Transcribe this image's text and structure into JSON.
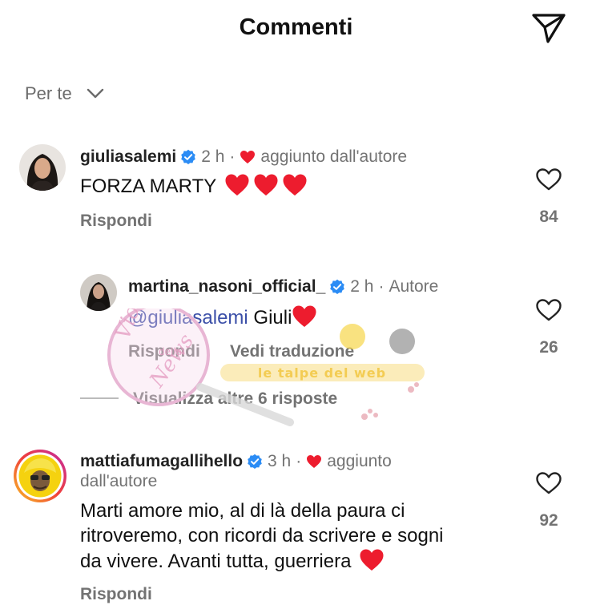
{
  "header": {
    "title": "Commenti",
    "share_icon": "paper-plane-icon"
  },
  "filter": {
    "label": "Per te",
    "icon": "chevron-down-icon"
  },
  "comments": [
    {
      "username": "giuliasalemi",
      "verified": true,
      "time": "2 h",
      "badge": "aggiunto dall'autore",
      "text": "FORZA MARTY",
      "hearts": 3,
      "reply_label": "Rispondi",
      "likes": "84"
    },
    {
      "username": "martina_nasoni_official_",
      "verified": true,
      "time": "2 h",
      "badge": "Autore",
      "mention": "@giuliasalemi",
      "text": " Giuli",
      "reply_label": "Rispondi",
      "translate_label": "Vedi traduzione",
      "likes": "26"
    },
    {
      "username": "mattiafumagallihello",
      "verified": true,
      "time": "3 h",
      "badge_line1": "aggiunto",
      "badge_line2": "dall'autore",
      "text_lines": [
        "Marti amore mio, al di là della paura ci",
        "ritroveremo, con ricordi da scrivere e sogni",
        "da vivere. Avanti tutta, guerriera"
      ],
      "reply_label": "Rispondi",
      "likes": "92"
    }
  ],
  "more_replies": {
    "label": "Visualizza altre 6 risposte"
  },
  "watermarks": {
    "stamp": [
      "Violo",
      "della",
      "News"
    ],
    "banner": "le talpe del web"
  },
  "colors": {
    "accent_red": "#ed1c2e",
    "verified_blue": "#2b8cf5",
    "mention_blue": "#3b4fa8",
    "gray": "#737373"
  }
}
